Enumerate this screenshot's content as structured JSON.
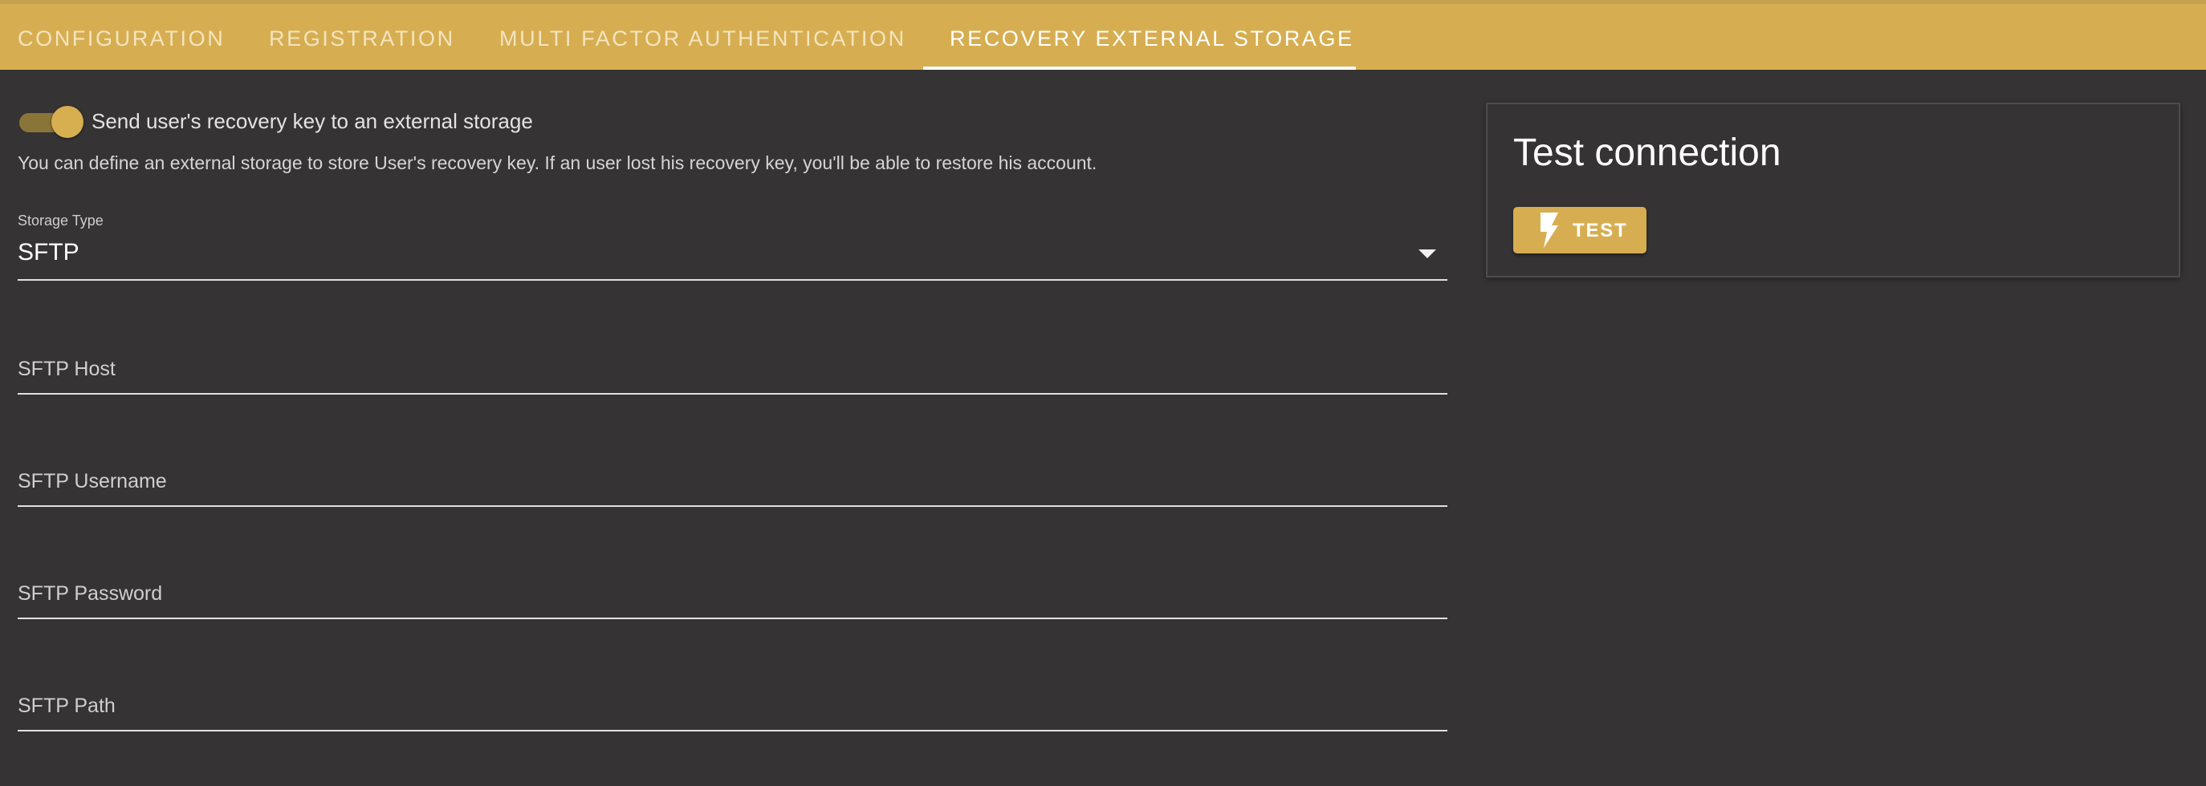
{
  "tabs": [
    {
      "label": "CONFIGURATION",
      "active": false
    },
    {
      "label": "REGISTRATION",
      "active": false
    },
    {
      "label": "MULTI FACTOR AUTHENTICATION",
      "active": false
    },
    {
      "label": "RECOVERY EXTERNAL STORAGE",
      "active": true
    }
  ],
  "toggle": {
    "label": "Send user's recovery key to an external storage",
    "checked": true
  },
  "description": "You can define an external storage to store User's recovery key. If an user lost his recovery key, you'll be able to restore his account.",
  "storage_type": {
    "label": "Storage Type",
    "value": "SFTP"
  },
  "fields": {
    "host": {
      "label": "SFTP Host",
      "value": ""
    },
    "username": {
      "label": "SFTP Username",
      "value": ""
    },
    "password": {
      "label": "SFTP Password",
      "value": ""
    },
    "path": {
      "label": "SFTP Path",
      "value": ""
    }
  },
  "test_card": {
    "title": "Test connection",
    "button_label": "TEST",
    "button_icon": "flash-icon"
  },
  "colors": {
    "accent": "#d6ae51",
    "background": "#353334",
    "text": "#e8e6e7"
  }
}
